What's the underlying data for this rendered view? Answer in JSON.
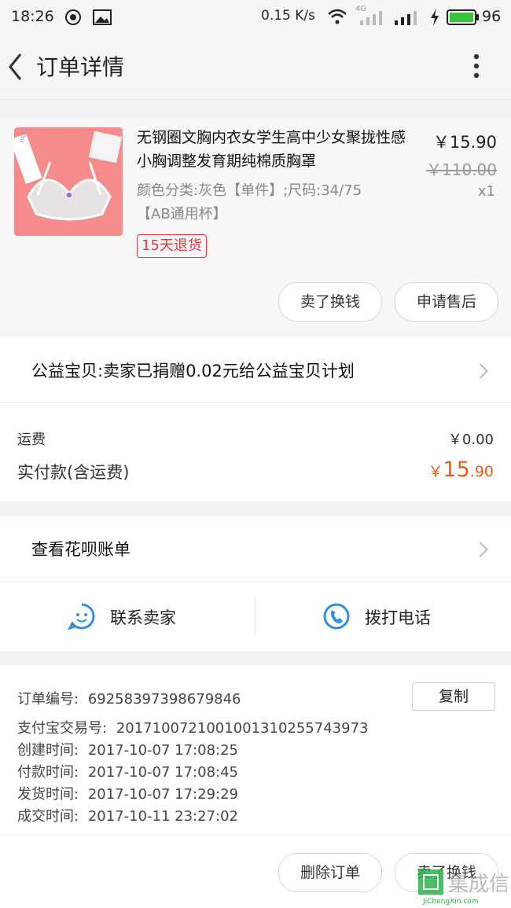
{
  "status_bar": {
    "time": "18:26",
    "speed": "0.15 K/s",
    "network": "4G",
    "battery": "96"
  },
  "header": {
    "title": "订单详情"
  },
  "product": {
    "title": "无钢圈文胸内衣女学生高中少女聚拢性感小胸调整发育期纯棉质胸罩",
    "sku": "颜色分类:灰色【单件】;尺码:34/75【AB通用杯】",
    "price": "￥15.90",
    "original_price": "￥110.00",
    "quantity": "x1",
    "badge": "15天退货",
    "image_tag": "BRA SUDDEN"
  },
  "product_actions": {
    "sell_label": "卖了换钱",
    "after_sale_label": "申请售后"
  },
  "charity": {
    "text": "公益宝贝:卖家已捐赠0.02元给公益宝贝计划"
  },
  "fees": {
    "shipping_label": "运费",
    "shipping_value": "￥0.00",
    "paid_label": "实付款(含运费)",
    "paid_currency": "￥",
    "paid_main": "15",
    "paid_decimal": ".90"
  },
  "huabei": {
    "text": "查看花呗账单"
  },
  "contact": {
    "seller_label": "联系卖家",
    "call_label": "拨打电话"
  },
  "order_info": {
    "order_no_label": "订单编号:",
    "order_no": "692583973986798​46",
    "copy_label": "复制",
    "alipay_label": "支付宝交易号:",
    "alipay_no": "2017100721001001310255743973",
    "created_label": "创建时间:",
    "created": "2017-10-07 17:08:25",
    "paid_label": "付款时间:",
    "paid": "2017-10-07 17:08:45",
    "shipped_label": "发货时间:",
    "shipped": "2017-10-07 17:29:29",
    "done_label": "成交时间:",
    "done": "2017-10-11 23:27:02"
  },
  "bottom_actions": {
    "delete_label": "删除订单",
    "sell_label": "卖了换钱"
  },
  "watermark": {
    "text": "集成信",
    "url_text": "JiChengXin.com"
  },
  "colors": {
    "accent_orange": "#f05a14",
    "badge_red": "#e0393e",
    "icon_blue": "#2e8fe0"
  }
}
